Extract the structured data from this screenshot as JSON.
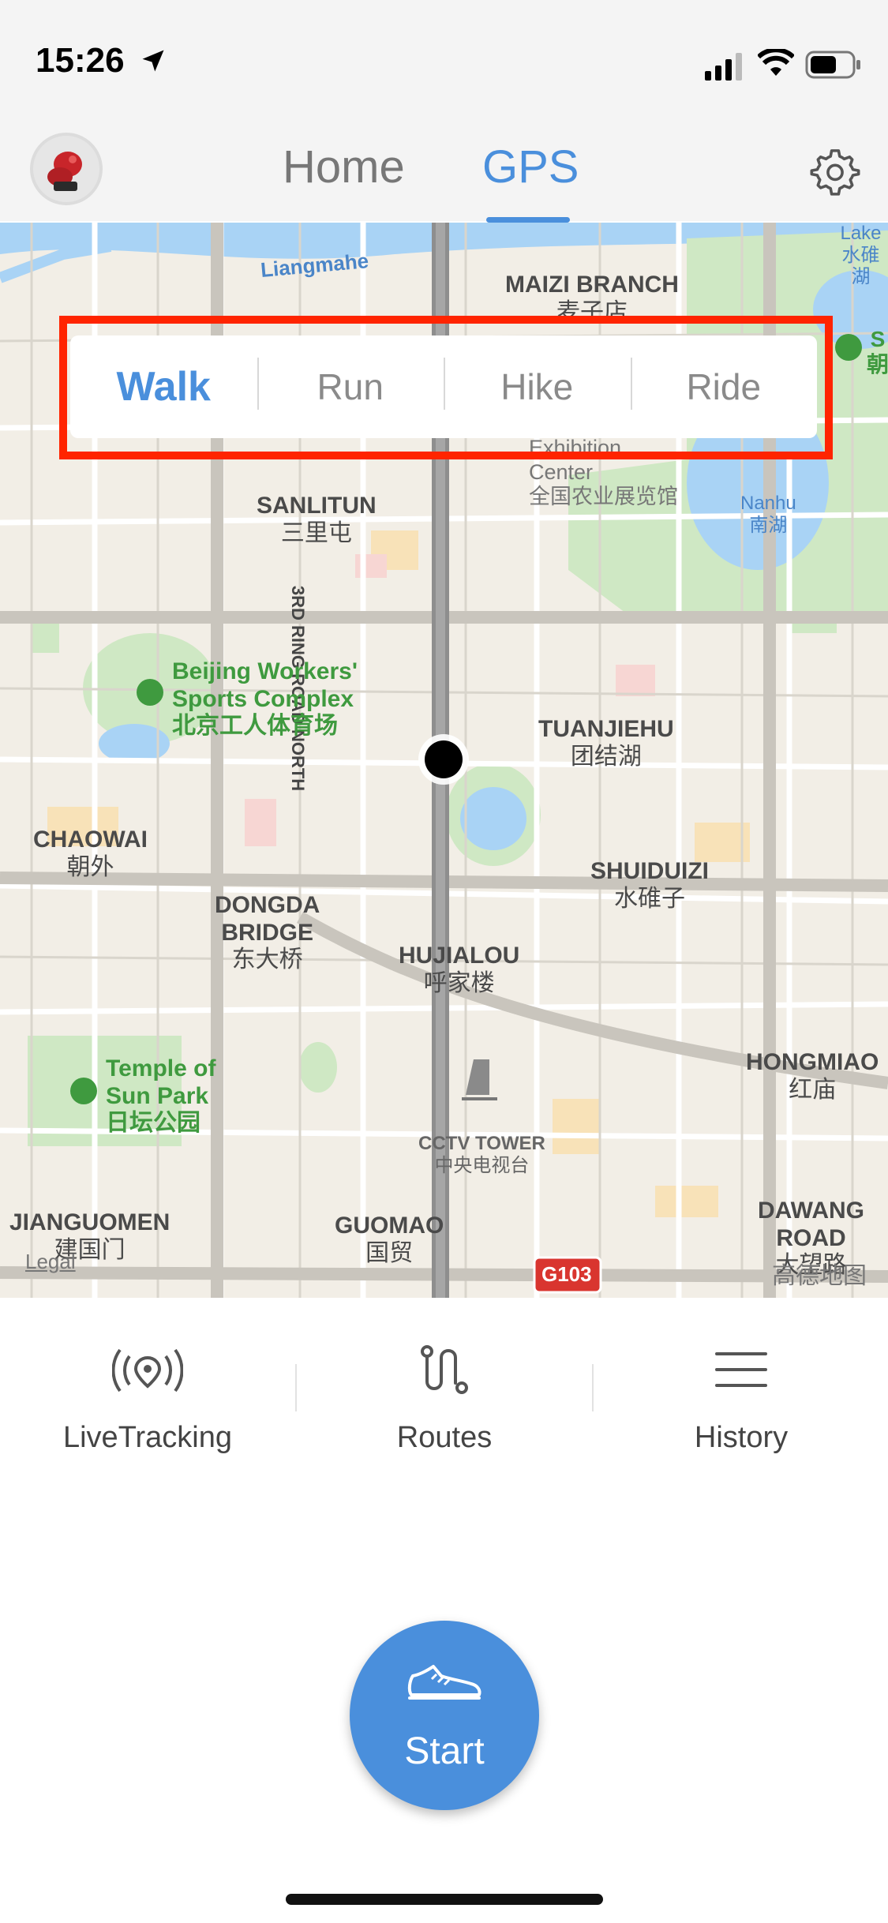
{
  "status_bar": {
    "time": "15:26"
  },
  "header": {
    "tabs": [
      {
        "label": "Home"
      },
      {
        "label": "GPS"
      }
    ],
    "active_tab": "GPS"
  },
  "activity_selector": {
    "options": [
      "Walk",
      "Run",
      "Hike",
      "Ride"
    ],
    "selected": "Walk"
  },
  "map": {
    "labels": {
      "liangmahe": "Liangmahe",
      "maizi_en": "MAIZI BRANCH",
      "maizi_cn": "麦子店",
      "lake_en": "Lake",
      "lake_cn": "水碓湖",
      "s_en": "S",
      "s_cn": "朝",
      "exhibition_en": "Exhibition",
      "exhibition_en2": "Center",
      "exhibition_cn": "全国农业展览馆",
      "sanlitun_en": "SANLITUN",
      "sanlitun_cn": "三里屯",
      "road_north": "3RD RING ROAD NORTH",
      "nanhu_en": "Nanhu",
      "nanhu_cn": "南湖",
      "workers_en1": "Beijing Workers'",
      "workers_en2": "Sports Complex",
      "workers_cn": "北京工人体育场",
      "tuanjiehu_en": "TUANJIEHU",
      "tuanjiehu_cn": "团结湖",
      "chaowai_en": "CHAOWAI",
      "chaowai_cn": "朝外",
      "shuiduizi_en": "SHUIDUIZI",
      "shuiduizi_cn": "水碓子",
      "dongda_en1": "DONGDA",
      "dongda_en2": "BRIDGE",
      "dongda_cn": "东大桥",
      "hujialou_en": "HUJIALOU",
      "hujialou_cn": "呼家楼",
      "hongmiao_en": "HONGMIAO",
      "hongmiao_cn": "红庙",
      "temple_en1": "Temple of",
      "temple_en2": "Sun Park",
      "temple_cn": "日坛公园",
      "cctv_en": "CCTV TOWER",
      "cctv_cn": "中央电视台",
      "jianguomen_en": "JIANGUOMEN",
      "jianguomen_cn": "建国门",
      "guomao_en": "GUOMAO",
      "guomao_cn": "国贸",
      "dawang_en": "DAWANG ROAD",
      "dawang_cn": "大望路",
      "g103": "G103",
      "legal": "Legal",
      "attribution": "高德地图"
    }
  },
  "bottom_nav": [
    {
      "label": "LiveTracking",
      "icon": "live-tracking-icon"
    },
    {
      "label": "Routes",
      "icon": "routes-icon"
    },
    {
      "label": "History",
      "icon": "history-list-icon"
    }
  ],
  "start_button": {
    "label": "Start",
    "icon": "sneaker-icon"
  },
  "colors": {
    "accent": "#4a8fdc",
    "highlight_frame": "#ff2400"
  }
}
